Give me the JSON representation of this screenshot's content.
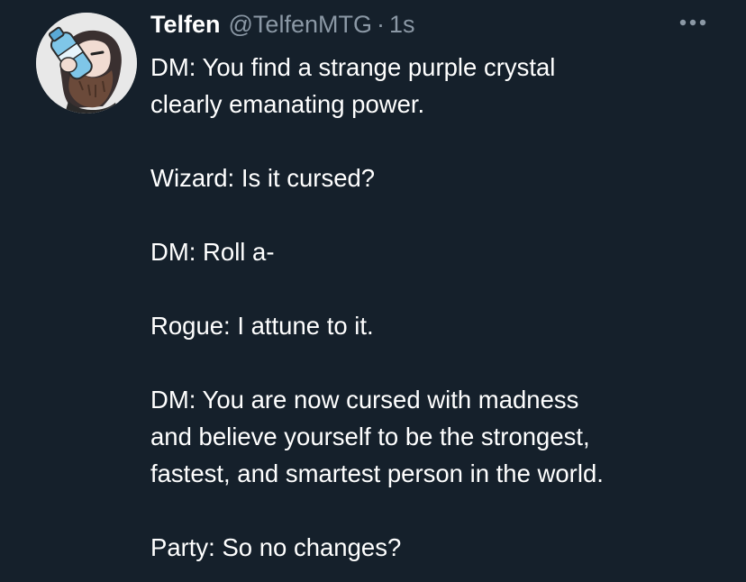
{
  "tweet": {
    "author": {
      "display_name": "Telfen",
      "handle": "@TelfenMTG",
      "separator": "·",
      "time": "1s",
      "avatar_icon": "cartoon-avatar-drinking-bottle"
    },
    "more_icon": "more-options-icon",
    "lines": [
      "DM: You find a strange purple crystal",
      "clearly emanating power.",
      "Wizard: Is it cursed?",
      "DM: Roll a-",
      "Rogue: I attune to it.",
      "DM: You are now cursed with madness",
      "and believe yourself to be the strongest,",
      "fastest, and smartest person in the world.",
      "Party: So no changes?"
    ]
  },
  "colors": {
    "background": "#15202b",
    "primary_text": "#ffffff",
    "secondary_text": "#8b98a5"
  }
}
